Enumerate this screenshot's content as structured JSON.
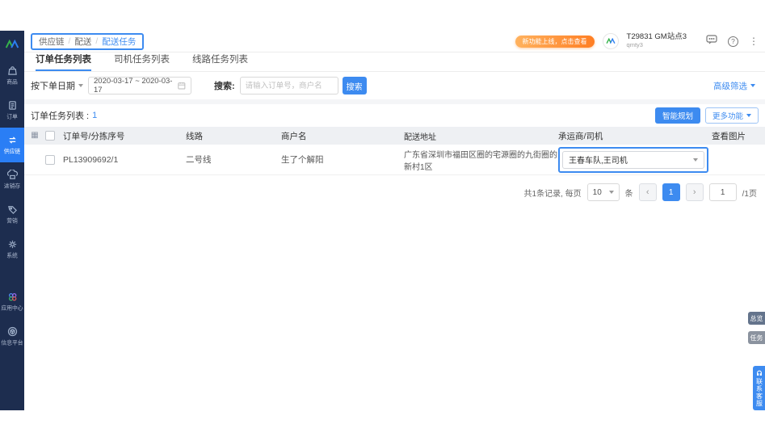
{
  "colors": {
    "primary": "#3d8bf0",
    "sidebar_bg": "#1d2d4f",
    "active_item": "#2a7ef5",
    "badge_orange": "#ff7e23"
  },
  "header": {
    "breadcrumb": {
      "level1": "供应链",
      "level2": "配送",
      "level3": "配送任务"
    },
    "promo_badge": "新功能上线，点击查看",
    "user": {
      "name": "T29831 GM站点3",
      "account": "qmty3"
    }
  },
  "sidebar": {
    "items": [
      {
        "label": "商品"
      },
      {
        "label": "订单"
      },
      {
        "label": "供应链"
      },
      {
        "label": "进销存"
      },
      {
        "label": "营销"
      },
      {
        "label": "系统"
      }
    ],
    "bottom_items": [
      {
        "label": "应用中心"
      },
      {
        "label": "信息平台"
      }
    ]
  },
  "tabs": {
    "tab1": "订单任务列表",
    "tab2": "司机任务列表",
    "tab3": "线路任务列表"
  },
  "filters": {
    "date_type": "按下单日期",
    "date_range": "2020-03-17 ~ 2020-03-17",
    "search_label": "搜索:",
    "search_placeholder": "请输入订单号，商户名",
    "search_button": "搜索",
    "advanced": "高级筛选"
  },
  "toolbar": {
    "list_title": "订单任务列表 :",
    "count": "1",
    "smart_plan": "智能规划",
    "more": "更多功能"
  },
  "table": {
    "columns": [
      "订单号/分拣序号",
      "线路",
      "商户名",
      "配送地址",
      "承运商/司机",
      "查看图片"
    ],
    "rows": [
      {
        "order_no": "PL13909692/1",
        "route": "二号线",
        "merchant": "生了个解阳",
        "address": "广东省深圳市福田区圈的宅源圈的九街圈的新村1区",
        "carrier": "王春车队,王司机"
      }
    ]
  },
  "pagination": {
    "total": "共1条记录, 每页",
    "page_size": "10",
    "unit": "条",
    "prev": "‹",
    "next": "›",
    "page": "1",
    "jump": "1",
    "total_pages": "/1页"
  },
  "float_buttons": {
    "overview": "总览",
    "task": "任务",
    "service": "联系客服"
  }
}
